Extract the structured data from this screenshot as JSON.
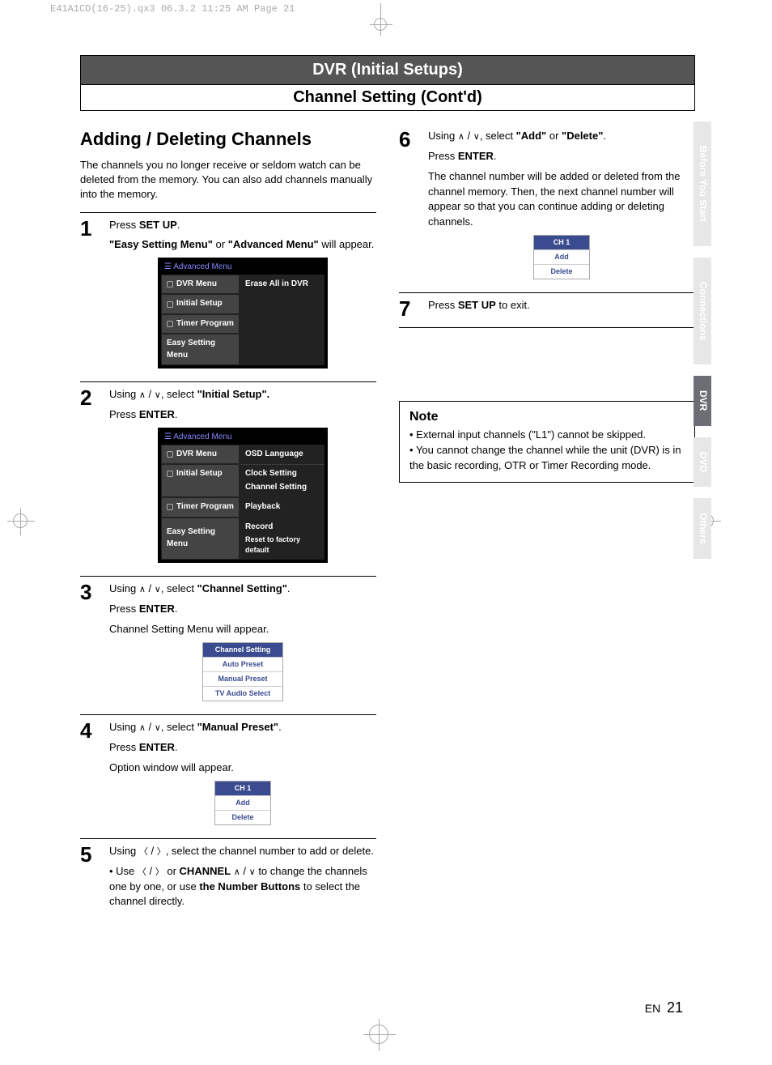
{
  "print_header": "E41A1CD(16-25).qx3  06.3.2 11:25 AM  Page 21",
  "banner": "DVR (Initial Setups)",
  "subbanner": "Channel Setting (Cont'd)",
  "section_title": "Adding / Deleting Channels",
  "intro": "The channels you no longer receive or seldom watch can be deleted from the memory. You can also add channels manually into the memory.",
  "steps": {
    "s1": {
      "num": "1",
      "l1a": "Press ",
      "l1b": "SET UP",
      "l1c": ".",
      "l2a": "\"Easy Setting Menu\"",
      "l2b": " or ",
      "l2c": "\"Advanced Menu\"",
      "l2d": " will appear."
    },
    "s2": {
      "num": "2",
      "l1a": "Using ",
      "l1b": " / ",
      "l1c": ", select ",
      "l1d": "\"Initial Setup\".",
      "l2a": "Press ",
      "l2b": "ENTER",
      "l2c": "."
    },
    "s3": {
      "num": "3",
      "l1a": "Using ",
      "l1b": " / ",
      "l1c": ", select ",
      "l1d": "\"Channel Setting\"",
      "l1e": ".",
      "l2a": "Press ",
      "l2b": "ENTER",
      "l2c": ".",
      "l3": "Channel Setting Menu will appear."
    },
    "s4": {
      "num": "4",
      "l1a": "Using  ",
      "l1b": " / ",
      "l1c": ", select ",
      "l1d": "\"Manual Preset\"",
      "l1e": ".",
      "l2a": "Press ",
      "l2b": "ENTER",
      "l2c": ".",
      "l3": "Option window will appear."
    },
    "s5": {
      "num": "5",
      "l1a": "Using ",
      "l1b": " / ",
      "l1c": ", select the channel number to add or delete.",
      "b1a": "• Use ",
      "b1b": " / ",
      "b1c": " or ",
      "b1d": "CHANNEL",
      "b1e": " ",
      "b1f": " / ",
      "b1g": " to change the channels one by one, or use ",
      "b1h": "the Number Buttons",
      "b1i": " to select the channel directly."
    },
    "s6": {
      "num": "6",
      "l1a": "Using ",
      "l1b": " / ",
      "l1c": ", select ",
      "l1d": "\"Add\"",
      "l1e": " or ",
      "l1f": "\"Delete\"",
      "l1g": ".",
      "l2a": "Press ",
      "l2b": "ENTER",
      "l2c": ".",
      "l3": "The channel number will be added or deleted from the channel memory.  Then, the next channel number will appear so that you can continue adding or deleting channels."
    },
    "s7": {
      "num": "7",
      "l1a": "Press ",
      "l1b": "SET UP",
      "l1c": " to exit."
    }
  },
  "osd1": {
    "header": "Advanced Menu",
    "left": [
      "DVR Menu",
      "Initial Setup",
      "Timer Program",
      "Easy Setting Menu"
    ],
    "right": [
      "Erase All in DVR",
      "",
      "",
      ""
    ]
  },
  "osd2": {
    "header": "Advanced Menu",
    "left": [
      "DVR Menu",
      "Initial Setup",
      "Timer Program",
      "Easy Setting Menu"
    ],
    "right_top": "OSD Language",
    "right": [
      "Clock Setting",
      "Channel Setting",
      "Playback",
      "Record",
      "Reset to factory default"
    ]
  },
  "osd3": {
    "header": "Channel Setting",
    "rows": [
      "Auto Preset",
      "Manual Preset",
      "TV Audio Select"
    ]
  },
  "osd4": {
    "header": "CH 1",
    "rows": [
      "Add",
      "Delete"
    ]
  },
  "osd6": {
    "header": "CH 1",
    "rows": [
      "Add",
      "Delete"
    ]
  },
  "note": {
    "title": "Note",
    "items": [
      "External input channels (\"L1\") cannot be skipped.",
      "You cannot change the channel while the unit (DVR) is in the basic recording, OTR or Timer Recording mode."
    ]
  },
  "tabs": [
    "Before You Start",
    "Connections",
    "DVR",
    "DVD",
    "Others"
  ],
  "footer_lang": "EN",
  "footer_page": "21"
}
